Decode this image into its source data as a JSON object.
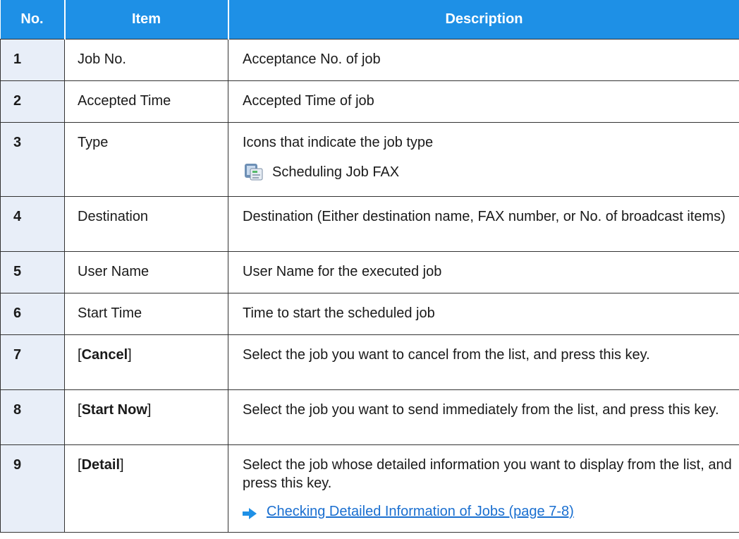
{
  "table": {
    "headers": {
      "no": "No.",
      "item": "Item",
      "description": "Description"
    },
    "rows": [
      {
        "no": "1",
        "item": "Job No.",
        "description": "Acceptance No. of job"
      },
      {
        "no": "2",
        "item": "Accepted Time",
        "description": "Accepted Time of job"
      },
      {
        "no": "3",
        "item": "Type",
        "description": "Icons that indicate the job type",
        "sub_icon": "fax-job-icon",
        "sub_text": "Scheduling Job FAX"
      },
      {
        "no": "4",
        "item": "Destination",
        "description": "Destination (Either destination name, FAX number, or No. of broadcast items)"
      },
      {
        "no": "5",
        "item": "User Name",
        "description": "User Name for the executed job"
      },
      {
        "no": "6",
        "item": "Start Time",
        "description": "Time to start the scheduled job"
      },
      {
        "no": "7",
        "item_key": "Cancel",
        "description": "Select the job you want to cancel from the list, and press this key."
      },
      {
        "no": "8",
        "item_key": "Start Now",
        "description": "Select the job you want to send immediately from the list, and press this key."
      },
      {
        "no": "9",
        "item_key": "Detail",
        "description": "Select the job whose detailed information you want to display from the list, and press this key.",
        "link_icon": "arrow-right-icon",
        "link_text": "Checking Detailed Information of Jobs (page 7-8)"
      }
    ],
    "bracket_open": "[",
    "bracket_close": "]"
  },
  "colors": {
    "header_bg": "#1e90e6",
    "number_col_bg": "#e8eef8",
    "link": "#1a6fd0",
    "arrow": "#1e90e6"
  }
}
